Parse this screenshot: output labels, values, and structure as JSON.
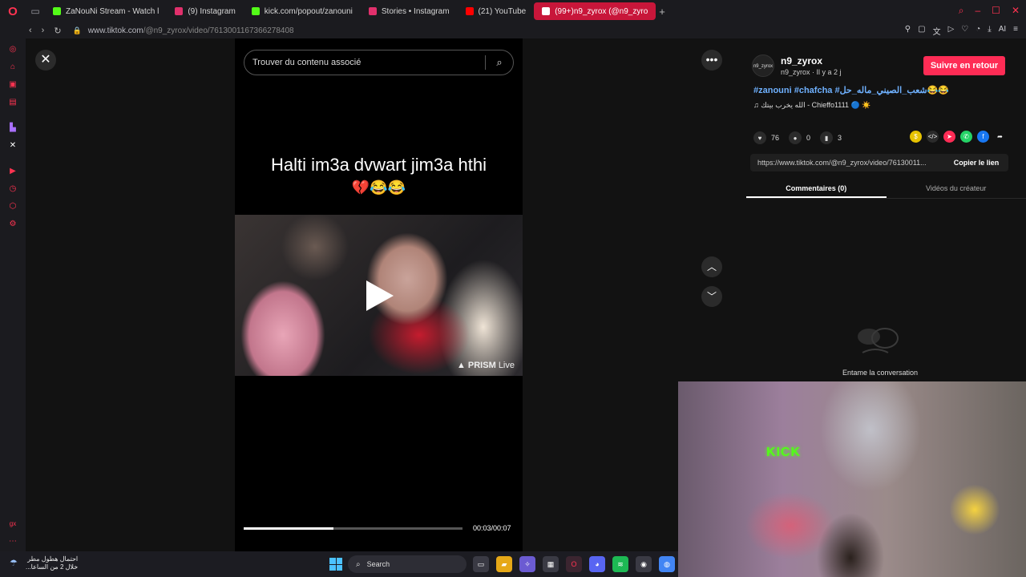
{
  "browser": {
    "tabs": [
      {
        "label": "ZaNouNi Stream - Watch l",
        "color": "#53fc18",
        "active": false
      },
      {
        "label": "(9) Instagram",
        "color": "#e1306c",
        "active": false
      },
      {
        "label": "kick.com/popout/zanouni",
        "color": "#53fc18",
        "active": false
      },
      {
        "label": "Stories • Instagram",
        "color": "#e1306c",
        "active": false
      },
      {
        "label": "(21) YouTube",
        "color": "#ff0000",
        "active": false
      },
      {
        "label": "(99+)n9_zyrox (@n9_zyro",
        "color": "#ffffff",
        "active": true
      }
    ],
    "url_host": "www.tiktok.com",
    "url_path": "/@n9_zyrox/video/7613001167366278408",
    "toolbar_ai_label": "AI"
  },
  "player": {
    "search_placeholder": "Trouver du contenu associé",
    "caption": "Halti im3a dvwart jim3a hthi",
    "caption_emoji": "💔😂😂",
    "watermark_brand": "PRISM",
    "watermark_suffix": "Live",
    "progress": 0.41,
    "time": "00:03/00:07"
  },
  "creator": {
    "avatar_text": "n9_zyrox",
    "name": "n9_zyrox",
    "meta": "n9_zyrox · Il y a 2 j",
    "follow_label": "Suivre en retour",
    "hashtags": "#zanouni #chafcha #شعب_الصيني_ماله_حل😂😂",
    "music": "♫  الله يخرب بيتك - Chieffo1111 🔵 ☀️",
    "likes": "76",
    "comments": "0",
    "saves": "3",
    "link": "https://www.tiktok.com/@n9_zyrox/video/76130011...",
    "copy_label": "Copier le lien"
  },
  "panel_tabs": [
    {
      "label": "Commentaires (0)",
      "active": true
    },
    {
      "label": "Vidéos du créateur",
      "active": false
    }
  ],
  "empty_state": "Entame la conversation",
  "webcam": {
    "sign": "KICK"
  },
  "taskbar": {
    "weather_line1": "احتمال هطول مطر",
    "weather_line2": "خلال 2 من الساعا...",
    "search_label": "Search"
  },
  "colors": {
    "accent": "#fe2c55",
    "opera": "#ff3351",
    "link": "#6fb1ff"
  }
}
